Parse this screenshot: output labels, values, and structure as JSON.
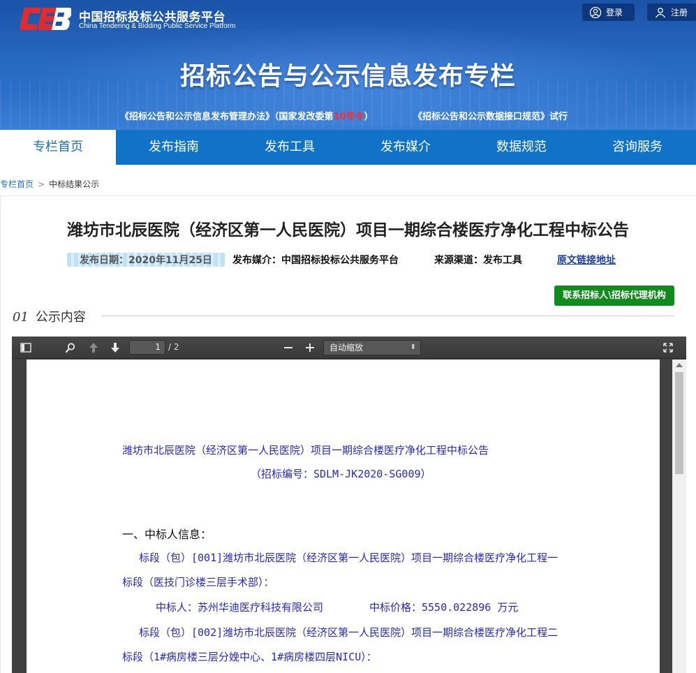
{
  "header": {
    "site_name_cn": "中国招标投标公共服务平台",
    "site_name_en": "China Tendering & Bidding Public Service Platform",
    "login_label": "登录",
    "register_label": "注册",
    "banner_title": "招标公告与公示信息发布专栏",
    "note_1_prefix": "《招标公告和公示信息发布管理办法》（国家发改委第",
    "note_1_num": "10号令",
    "note_1_suffix": "）",
    "note_2": "《招标公告和公示数据接口规范》试行"
  },
  "nav": {
    "items": [
      "专栏首页",
      "发布指南",
      "发布工具",
      "发布媒介",
      "数据规范",
      "咨询服务"
    ],
    "active": "专栏首页"
  },
  "breadcrumb": {
    "home": "专栏首页",
    "sep": ">",
    "current": "中标结果公示"
  },
  "article": {
    "title": "潍坊市北辰医院（经济区第一人民医院）项目一期综合楼医疗净化工程中标公告",
    "date": "发布日期：2020年11月25日",
    "media": "发布媒介：中国招标投标公共服务平台",
    "channel": "来源渠道：发布工具",
    "source_link": "原文链接地址",
    "contact_button": "联系招标人\\招标代理机构",
    "section_num": "01",
    "section_title": "公示内容"
  },
  "pdf_viewer": {
    "page_current": "1",
    "page_total": "/ 2",
    "zoom": "自动缩放",
    "doc_title": "潍坊市北辰医院（经济区第一人民医院）项目一期综合楼医疗净化工程中标公告",
    "doc_code": "（招标编号：SDLM-JK2020-SG009）",
    "h1": "一、中标人信息：",
    "lot1_line1": "标段（包）[001]潍坊市北辰医院（经济区第一人民医院）项目一期综合楼医疗净化工程一",
    "lot1_line2": "标段（医技门诊楼三层手术部）：",
    "winner_1": "中标人：苏州华迪医疗科技有限公司",
    "price_1": "中标价格：5550.022896 万元",
    "lot2_line1": "标段（包）[002]潍坊市北辰医院（经济区第一人民医院）项目一期综合楼医疗净化工程二",
    "lot2_line2": "标段（1#病房楼三层分娩中心、1#病房楼四层NICU）："
  }
}
